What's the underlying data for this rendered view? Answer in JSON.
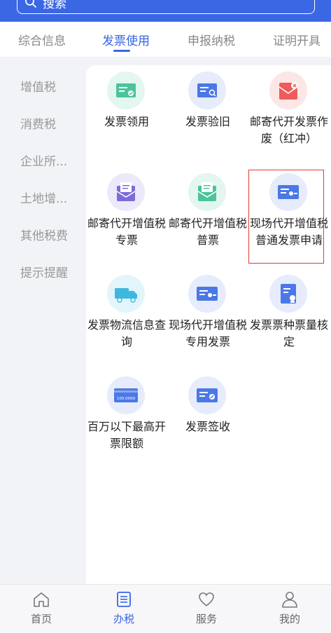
{
  "search": {
    "placeholder": "搜索"
  },
  "tabs": [
    {
      "label": "综合信息"
    },
    {
      "label": "发票使用"
    },
    {
      "label": "申报纳税"
    },
    {
      "label": "证明开具"
    }
  ],
  "sidebar": {
    "items": [
      {
        "label": "增值税"
      },
      {
        "label": "消费税"
      },
      {
        "label": "企业所..."
      },
      {
        "label": "土地增..."
      },
      {
        "label": "其他税费"
      },
      {
        "label": "提示提醒"
      }
    ]
  },
  "grid": {
    "items": [
      {
        "label": "发票领用",
        "icon": "invoice-check-icon"
      },
      {
        "label": "发票验旧",
        "icon": "invoice-search-icon"
      },
      {
        "label": "邮寄代开发票作废（红冲）",
        "icon": "mail-cancel-icon"
      },
      {
        "label": "邮寄代开增值税专票",
        "icon": "mail-special-invoice-icon"
      },
      {
        "label": "邮寄代开增值税普票",
        "icon": "mail-normal-invoice-icon"
      },
      {
        "label": "现场代开增值税普通发票申请",
        "icon": "onsite-invoice-icon"
      },
      {
        "label": "发票物流信息查询",
        "icon": "truck-icon"
      },
      {
        "label": "现场代开增值税专用发票",
        "icon": "onsite-special-invoice-icon"
      },
      {
        "label": "发票票种票量核定",
        "icon": "document-stamp-icon"
      },
      {
        "label": "百万以下最高开票限额",
        "icon": "limit-card-icon"
      },
      {
        "label": "发票签收",
        "icon": "invoice-sign-icon"
      }
    ],
    "card_amount": "100.0000"
  },
  "bottom_nav": {
    "items": [
      {
        "label": "首页",
        "icon": "home-icon"
      },
      {
        "label": "办税",
        "icon": "list-icon"
      },
      {
        "label": "服务",
        "icon": "heart-icon"
      },
      {
        "label": "我的",
        "icon": "user-icon"
      }
    ]
  },
  "colors": {
    "accent": "#3a67e4",
    "highlight": "#e53935"
  }
}
